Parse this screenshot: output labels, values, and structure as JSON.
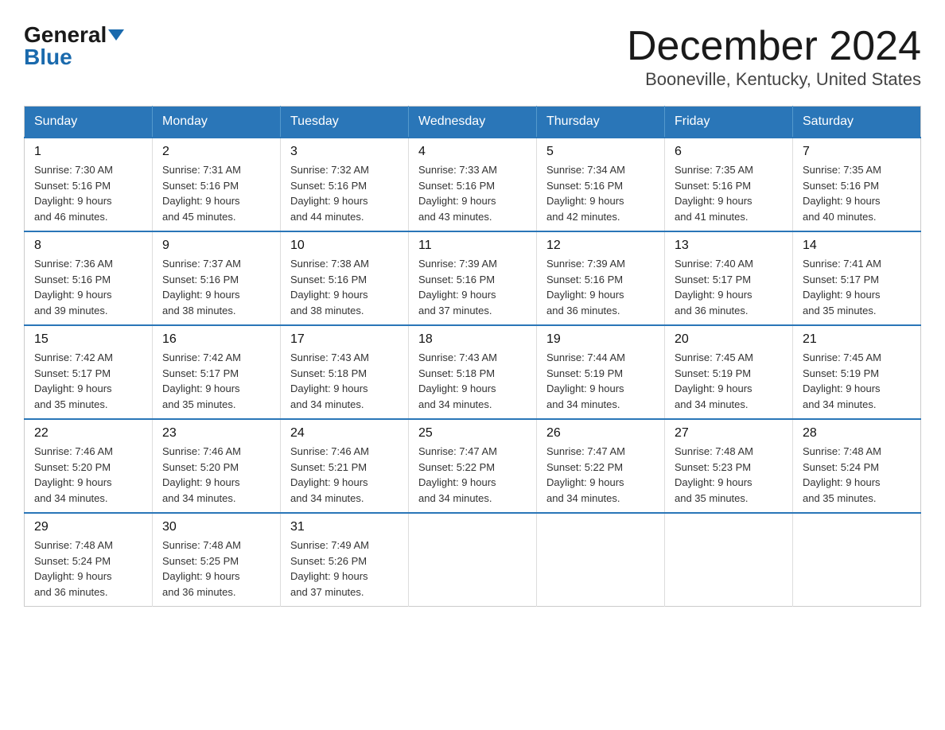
{
  "header": {
    "logo_general": "General",
    "logo_blue": "Blue",
    "title": "December 2024",
    "subtitle": "Booneville, Kentucky, United States"
  },
  "calendar": {
    "weekdays": [
      "Sunday",
      "Monday",
      "Tuesday",
      "Wednesday",
      "Thursday",
      "Friday",
      "Saturday"
    ],
    "rows": [
      [
        {
          "day": "1",
          "sunrise": "7:30 AM",
          "sunset": "5:16 PM",
          "daylight": "9 hours and 46 minutes."
        },
        {
          "day": "2",
          "sunrise": "7:31 AM",
          "sunset": "5:16 PM",
          "daylight": "9 hours and 45 minutes."
        },
        {
          "day": "3",
          "sunrise": "7:32 AM",
          "sunset": "5:16 PM",
          "daylight": "9 hours and 44 minutes."
        },
        {
          "day": "4",
          "sunrise": "7:33 AM",
          "sunset": "5:16 PM",
          "daylight": "9 hours and 43 minutes."
        },
        {
          "day": "5",
          "sunrise": "7:34 AM",
          "sunset": "5:16 PM",
          "daylight": "9 hours and 42 minutes."
        },
        {
          "day": "6",
          "sunrise": "7:35 AM",
          "sunset": "5:16 PM",
          "daylight": "9 hours and 41 minutes."
        },
        {
          "day": "7",
          "sunrise": "7:35 AM",
          "sunset": "5:16 PM",
          "daylight": "9 hours and 40 minutes."
        }
      ],
      [
        {
          "day": "8",
          "sunrise": "7:36 AM",
          "sunset": "5:16 PM",
          "daylight": "9 hours and 39 minutes."
        },
        {
          "day": "9",
          "sunrise": "7:37 AM",
          "sunset": "5:16 PM",
          "daylight": "9 hours and 38 minutes."
        },
        {
          "day": "10",
          "sunrise": "7:38 AM",
          "sunset": "5:16 PM",
          "daylight": "9 hours and 38 minutes."
        },
        {
          "day": "11",
          "sunrise": "7:39 AM",
          "sunset": "5:16 PM",
          "daylight": "9 hours and 37 minutes."
        },
        {
          "day": "12",
          "sunrise": "7:39 AM",
          "sunset": "5:16 PM",
          "daylight": "9 hours and 36 minutes."
        },
        {
          "day": "13",
          "sunrise": "7:40 AM",
          "sunset": "5:17 PM",
          "daylight": "9 hours and 36 minutes."
        },
        {
          "day": "14",
          "sunrise": "7:41 AM",
          "sunset": "5:17 PM",
          "daylight": "9 hours and 35 minutes."
        }
      ],
      [
        {
          "day": "15",
          "sunrise": "7:42 AM",
          "sunset": "5:17 PM",
          "daylight": "9 hours and 35 minutes."
        },
        {
          "day": "16",
          "sunrise": "7:42 AM",
          "sunset": "5:17 PM",
          "daylight": "9 hours and 35 minutes."
        },
        {
          "day": "17",
          "sunrise": "7:43 AM",
          "sunset": "5:18 PM",
          "daylight": "9 hours and 34 minutes."
        },
        {
          "day": "18",
          "sunrise": "7:43 AM",
          "sunset": "5:18 PM",
          "daylight": "9 hours and 34 minutes."
        },
        {
          "day": "19",
          "sunrise": "7:44 AM",
          "sunset": "5:19 PM",
          "daylight": "9 hours and 34 minutes."
        },
        {
          "day": "20",
          "sunrise": "7:45 AM",
          "sunset": "5:19 PM",
          "daylight": "9 hours and 34 minutes."
        },
        {
          "day": "21",
          "sunrise": "7:45 AM",
          "sunset": "5:19 PM",
          "daylight": "9 hours and 34 minutes."
        }
      ],
      [
        {
          "day": "22",
          "sunrise": "7:46 AM",
          "sunset": "5:20 PM",
          "daylight": "9 hours and 34 minutes."
        },
        {
          "day": "23",
          "sunrise": "7:46 AM",
          "sunset": "5:20 PM",
          "daylight": "9 hours and 34 minutes."
        },
        {
          "day": "24",
          "sunrise": "7:46 AM",
          "sunset": "5:21 PM",
          "daylight": "9 hours and 34 minutes."
        },
        {
          "day": "25",
          "sunrise": "7:47 AM",
          "sunset": "5:22 PM",
          "daylight": "9 hours and 34 minutes."
        },
        {
          "day": "26",
          "sunrise": "7:47 AM",
          "sunset": "5:22 PM",
          "daylight": "9 hours and 34 minutes."
        },
        {
          "day": "27",
          "sunrise": "7:48 AM",
          "sunset": "5:23 PM",
          "daylight": "9 hours and 35 minutes."
        },
        {
          "day": "28",
          "sunrise": "7:48 AM",
          "sunset": "5:24 PM",
          "daylight": "9 hours and 35 minutes."
        }
      ],
      [
        {
          "day": "29",
          "sunrise": "7:48 AM",
          "sunset": "5:24 PM",
          "daylight": "9 hours and 36 minutes."
        },
        {
          "day": "30",
          "sunrise": "7:48 AM",
          "sunset": "5:25 PM",
          "daylight": "9 hours and 36 minutes."
        },
        {
          "day": "31",
          "sunrise": "7:49 AM",
          "sunset": "5:26 PM",
          "daylight": "9 hours and 37 minutes."
        },
        null,
        null,
        null,
        null
      ]
    ]
  }
}
